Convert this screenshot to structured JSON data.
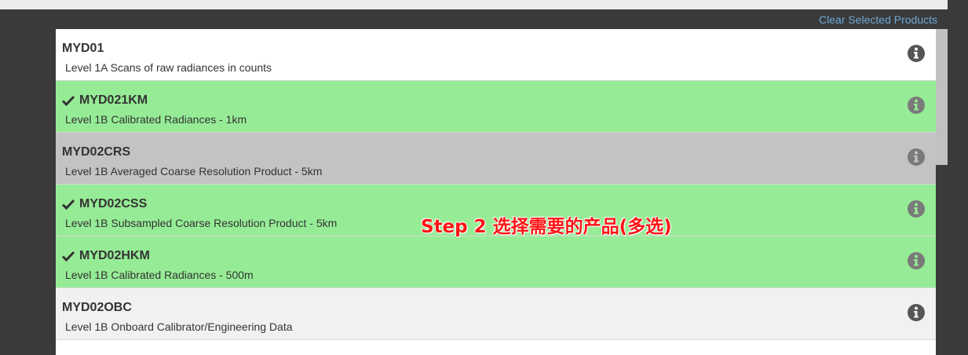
{
  "header": {
    "clear_label": "Clear Selected Products"
  },
  "products": [
    {
      "code": "MYD01",
      "description": "Level 1A Scans of raw radiances in counts",
      "selected": false,
      "state": "white"
    },
    {
      "code": "MYD021KM",
      "description": "Level 1B Calibrated Radiances - 1km",
      "selected": true,
      "state": "green"
    },
    {
      "code": "MYD02CRS",
      "description": "Level 1B Averaged Coarse Resolution Product - 5km",
      "selected": false,
      "state": "gray"
    },
    {
      "code": "MYD02CSS",
      "description": "Level 1B Subsampled Coarse Resolution Product - 5km",
      "selected": true,
      "state": "green"
    },
    {
      "code": "MYD02HKM",
      "description": "Level 1B Calibrated Radiances - 500m",
      "selected": true,
      "state": "green"
    },
    {
      "code": "MYD02OBC",
      "description": "Level 1B Onboard Calibrator/Engineering Data",
      "selected": false,
      "state": "light"
    }
  ],
  "annotation": {
    "text": "Step 2 选择需要的产品(多选)"
  },
  "colors": {
    "selected_bg": "#96ec96",
    "hover_bg": "#c3c3c3",
    "link": "#6fa8d6",
    "annotation": "#ff1414"
  },
  "icons": {
    "check": "check-icon",
    "info": "info-icon"
  }
}
